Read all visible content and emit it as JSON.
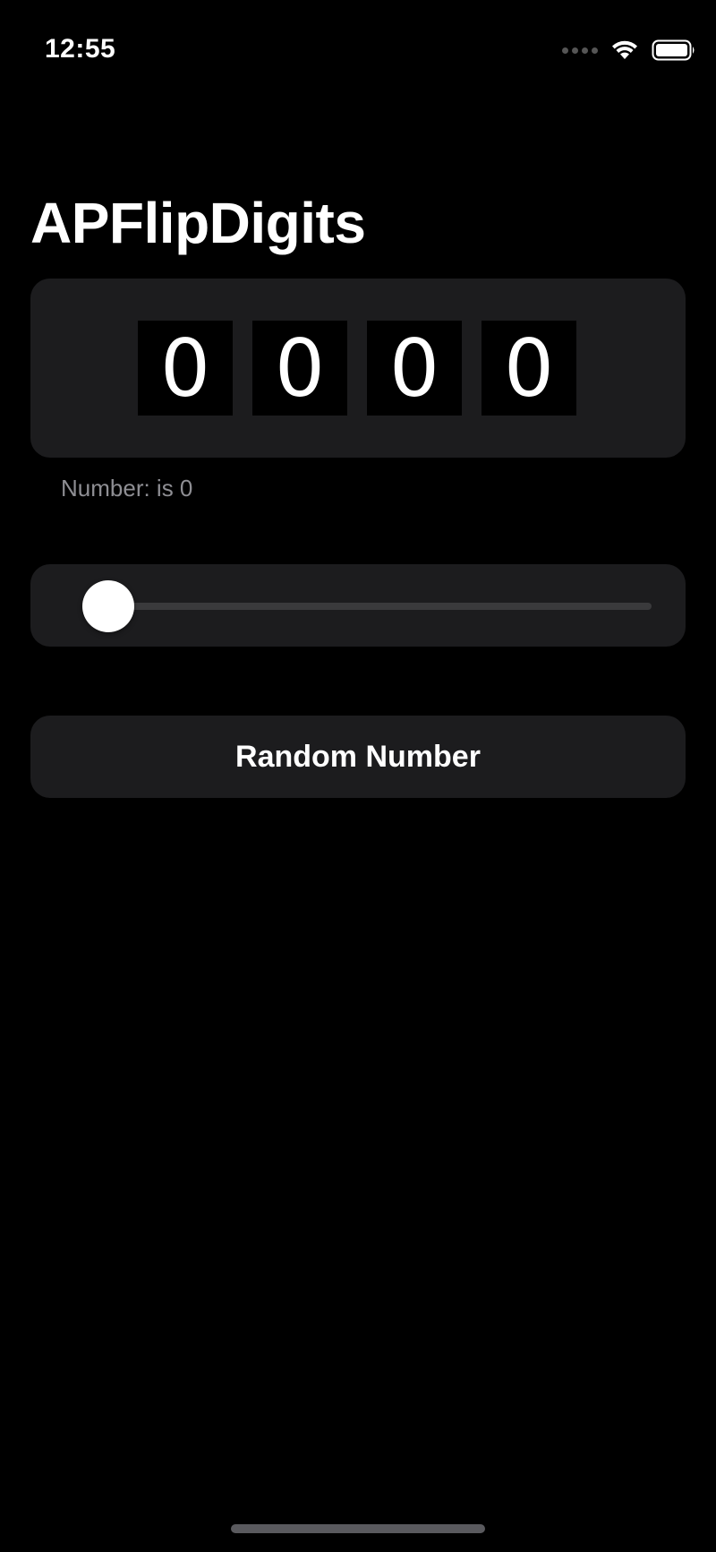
{
  "status_bar": {
    "time": "12:55",
    "icons": [
      "cellular-signal-icon",
      "wifi-icon",
      "battery-icon"
    ]
  },
  "page": {
    "title": "APFlipDigits"
  },
  "flip_digits": {
    "digits": [
      "0",
      "0",
      "0",
      "0"
    ]
  },
  "number_label": "Number: is 0",
  "slider": {
    "value_fraction": 0.0
  },
  "random_button": {
    "label": "Random Number"
  },
  "colors": {
    "background": "#000000",
    "card": "#1c1c1e",
    "secondary_text": "#8e8e93",
    "track": "#3a3a3c",
    "accent": "#0a84ff"
  }
}
